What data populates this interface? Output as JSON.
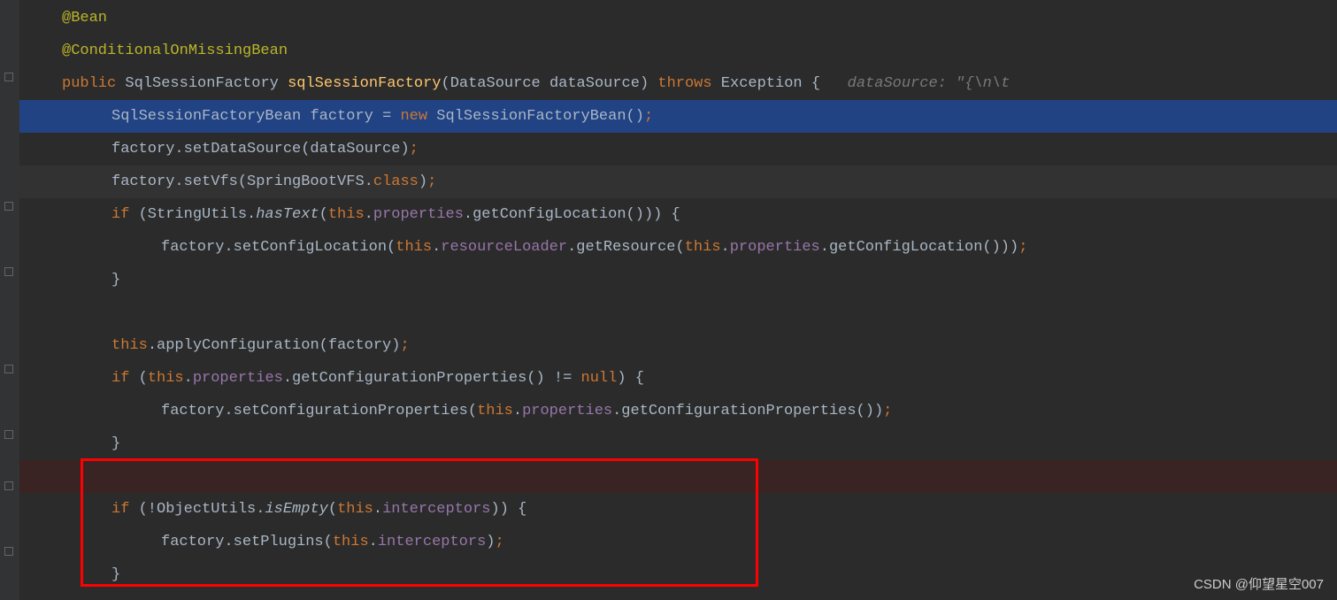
{
  "code": {
    "line1": {
      "annotation": "@Bean"
    },
    "line2": {
      "annotation": "@ConditionalOnMissingBean"
    },
    "line3": {
      "public": "public",
      "type1": "SqlSessionFactory",
      "method": "sqlSessionFactory",
      "paren1": "(",
      "type2": "DataSource",
      "param": "dataSource",
      "paren2": ") ",
      "throws": "throws",
      "exception": "Exception",
      "brace": " {",
      "hint": "   dataSource: \"{\\n\\t"
    },
    "line4": {
      "type": "SqlSessionFactoryBean",
      "var": "factory = ",
      "new": "new",
      "ctor": " SqlSessionFactoryBean()",
      "semi": ";"
    },
    "line5": {
      "var": "factory.setDataSource(dataSource)",
      "semi": ";"
    },
    "line6": {
      "var": "factory.setVfs(SpringBootVFS.",
      "class": "class",
      "paren": ")",
      "semi": ";"
    },
    "line7": {
      "if": "if",
      "paren1": " (StringUtils.",
      "method": "hasText",
      "paren2": "(",
      "this": "this",
      "dot1": ".",
      "field1": "properties",
      "call": ".getConfigLocation())) {"
    },
    "line8": {
      "var": "factory.setConfigLocation(",
      "this1": "this",
      "dot1": ".",
      "field1": "resourceLoader",
      "call1": ".getResource(",
      "this2": "this",
      "dot2": ".",
      "field2": "properties",
      "call2": ".getConfigLocation()))",
      "semi": ";"
    },
    "line9": {
      "brace": "}"
    },
    "line10": "",
    "line11": {
      "this": "this",
      "call": ".applyConfiguration(factory)",
      "semi": ";"
    },
    "line12": {
      "if": "if",
      "paren1": " (",
      "this": "this",
      "dot": ".",
      "field": "properties",
      "call": ".getConfigurationProperties() != ",
      "null": "null",
      "brace": ") {"
    },
    "line13": {
      "var": "factory.setConfigurationProperties(",
      "this": "this",
      "dot": ".",
      "field": "properties",
      "call": ".getConfigurationProperties())",
      "semi": ";"
    },
    "line14": {
      "brace": "}"
    },
    "line15": "",
    "line16": {
      "if": "if",
      "paren1": " (!ObjectUtils.",
      "method": "isEmpty",
      "paren2": "(",
      "this": "this",
      "dot": ".",
      "field": "interceptors",
      "brace": ")) {"
    },
    "line17": {
      "var": "factory.setPlugins(",
      "this": "this",
      "dot": ".",
      "field": "interceptors",
      "paren": ")",
      "semi": ";"
    },
    "line18": {
      "brace": "}"
    }
  },
  "watermark": "CSDN @仰望星空007"
}
